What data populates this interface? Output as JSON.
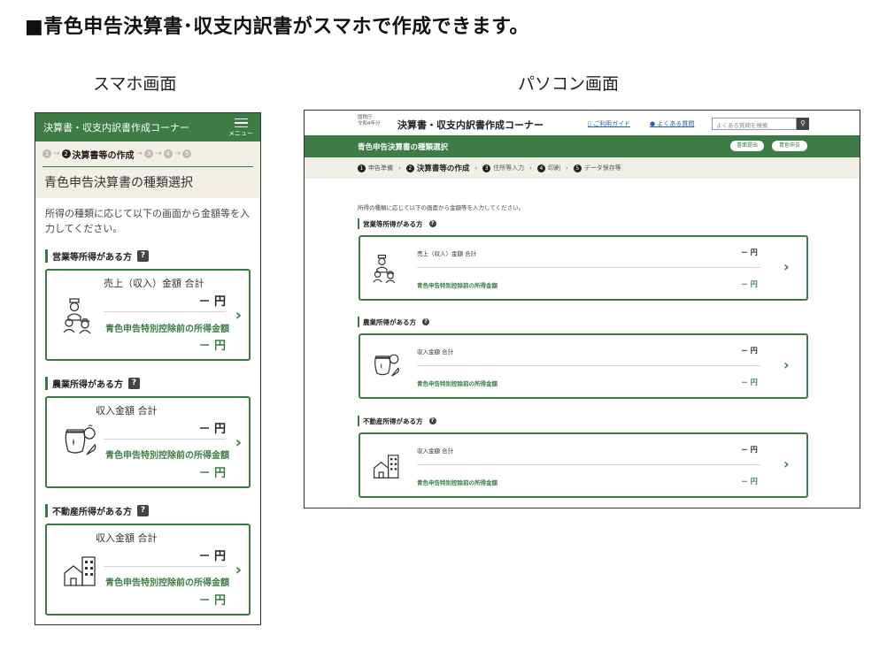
{
  "headline": "■青色申告決算書･収支内訳書がスマホで作成できます。",
  "captions": {
    "phone": "スマホ画面",
    "pc": "パソコン画面"
  },
  "colors": {
    "brand_green": "#3d7c44",
    "step_bg": "#f1efe6",
    "link_blue": "#2a5db0"
  },
  "phone": {
    "app_title": "決算書・収支内訳書作成コーナー",
    "menu_label": "メニュー",
    "steps": {
      "n1": "1",
      "n2": "2",
      "current": "決算書等の作成",
      "n3": "3",
      "n4": "4",
      "n5": "5"
    },
    "page_title": "青色申告決算書の種類選択",
    "intro": "所得の種類に応じて以下の画面から金額等を入力してください。",
    "help_mark": "?",
    "sections": [
      {
        "heading": "営業等所得がある方",
        "icon": "merchant-people-icon",
        "label1": "売上（収入）金額 合計",
        "value1": "－ 円",
        "label2": "青色申告特別控除前の所得金額",
        "value2": "－ 円"
      },
      {
        "heading": "農業所得がある方",
        "icon": "farm-produce-icon",
        "label1": "収入金額 合計",
        "value1": "－ 円",
        "label2": "青色申告特別控除前の所得金額",
        "value2": "－ 円"
      },
      {
        "heading": "不動産所得がある方",
        "icon": "building-icon",
        "label1": "収入金額 合計",
        "value1": "－ 円",
        "label2": "青色申告特別控除前の所得金額",
        "value2": "－ 円"
      }
    ],
    "chevron": "›"
  },
  "pc": {
    "org_line1": "国税庁",
    "org_line2": "令和4年分",
    "app_title": "決算書・収支内訳書作成コーナー",
    "guide_link": "ご利用ガイド",
    "faq_link": "よくある質問",
    "search_placeholder": "よくある質問を検索",
    "search_glyph": "⚲",
    "page_title": "青色申告決算書の種類選択",
    "btn_submit": "書面提出",
    "btn_blue": "青色申告",
    "steps": [
      {
        "n": "1",
        "label": "申告準備"
      },
      {
        "n": "2",
        "label": "決算書等の作成"
      },
      {
        "n": "3",
        "label": "住所等入力"
      },
      {
        "n": "4",
        "label": "印刷"
      },
      {
        "n": "5",
        "label": "データ保存等"
      }
    ],
    "arrow": "›",
    "intro": "所得の種類に応じて以下の画面から金額等を入力してください。",
    "help_mark": "?",
    "sections": [
      {
        "heading": "営業等所得がある方",
        "label1": "売上（収入）金額 合計",
        "value1": "－ 円",
        "label2": "青色申告特別控除前の所得金額",
        "value2": "－ 円"
      },
      {
        "heading": "農業所得がある方",
        "label1": "収入金額 合計",
        "value1": "－ 円",
        "label2": "青色申告特別控除前の所得金額",
        "value2": "－ 円"
      },
      {
        "heading": "不動産所得がある方",
        "label1": "収入金額 合計",
        "value1": "－ 円",
        "label2": "青色申告特別控除前の所得金額",
        "value2": "－ 円"
      }
    ],
    "chevron": "›"
  }
}
